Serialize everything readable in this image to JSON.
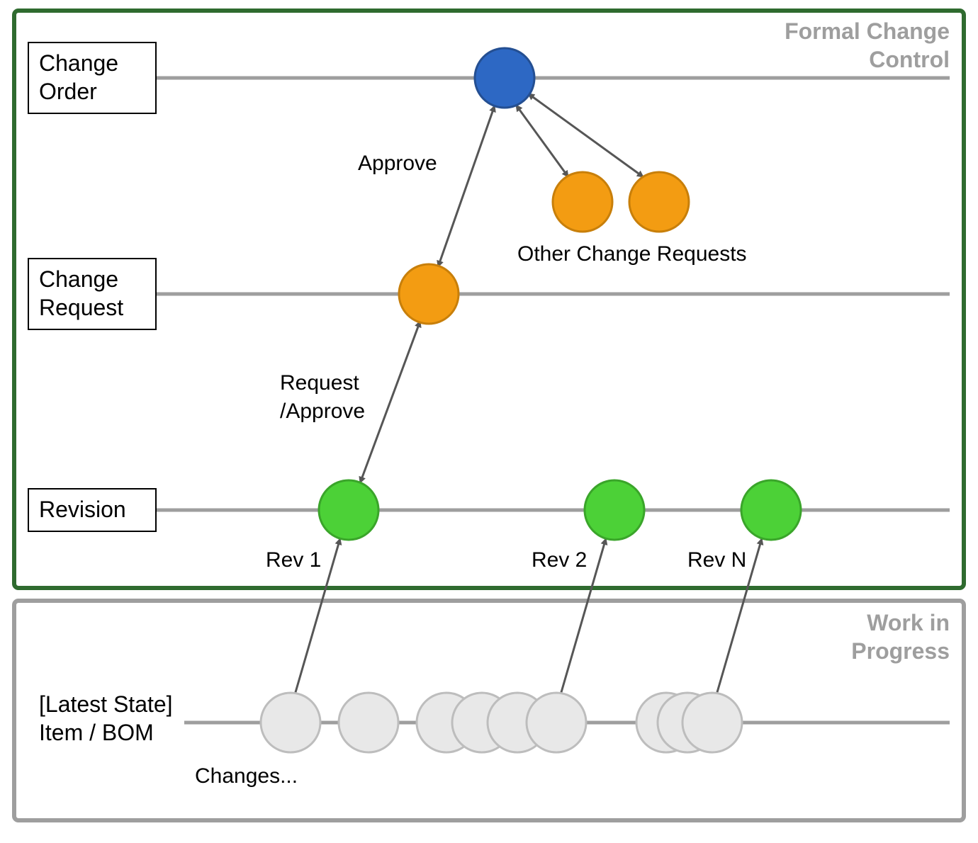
{
  "boxes": {
    "formal": {
      "title_line1": "Formal Change",
      "title_line2": "Control"
    },
    "wip": {
      "title_line1": "Work in",
      "title_line2": "Progress"
    }
  },
  "lanes": {
    "change_order": {
      "line1": "Change",
      "line2": "Order"
    },
    "change_request": {
      "line1": "Change",
      "line2": "Request"
    },
    "revision": {
      "line1": "Revision",
      "line2": ""
    },
    "latest_state": {
      "line1": "[Latest State]",
      "line2": "Item / BOM"
    }
  },
  "labels": {
    "approve": "Approve",
    "request_approve_line1": "Request",
    "request_approve_line2": "/Approve",
    "other_change_requests": "Other Change Requests",
    "rev1": "Rev 1",
    "rev2": "Rev 2",
    "revN": "Rev N",
    "changes": "Changes..."
  },
  "colors": {
    "green_box": "#2f6b2f",
    "grey_box": "#9e9e9e",
    "lane_line": "#9e9e9e",
    "blue_fill": "#2d68c4",
    "blue_stroke": "#244f92",
    "orange_fill": "#f39c12",
    "orange_stroke": "#c87f0a",
    "green_fill": "#4cd137",
    "green_stroke": "#3aa52a",
    "wip_fill": "#e8e8e8",
    "wip_stroke": "#bdbdbd",
    "arrow": "#565656"
  },
  "chart_data": {
    "type": "diagram",
    "title": "Formal Change Control vs Work in Progress",
    "lanes": [
      {
        "name": "Change Order",
        "box": "formal",
        "nodes": [
          {
            "id": "CO",
            "color": "blue"
          }
        ]
      },
      {
        "name": "Change Request",
        "box": "formal",
        "nodes": [
          {
            "id": "CR",
            "color": "orange"
          },
          {
            "id": "OCR1",
            "color": "orange",
            "label_group": "Other Change Requests"
          },
          {
            "id": "OCR2",
            "color": "orange",
            "label_group": "Other Change Requests"
          }
        ]
      },
      {
        "name": "Revision",
        "box": "formal",
        "nodes": [
          {
            "id": "Rev1",
            "color": "green",
            "label": "Rev 1"
          },
          {
            "id": "Rev2",
            "color": "green",
            "label": "Rev 2"
          },
          {
            "id": "RevN",
            "color": "green",
            "label": "Rev N"
          }
        ]
      },
      {
        "name": "[Latest State] Item / BOM",
        "box": "wip",
        "nodes": [
          {
            "id": "W1",
            "color": "grey",
            "group": 1
          },
          {
            "id": "W2",
            "color": "grey",
            "group": 1
          },
          {
            "id": "W3",
            "color": "grey",
            "group": 2
          },
          {
            "id": "W4",
            "color": "grey",
            "group": 2
          },
          {
            "id": "W5",
            "color": "grey",
            "group": 2
          },
          {
            "id": "W6",
            "color": "grey",
            "group": 2
          },
          {
            "id": "W7",
            "color": "grey",
            "group": 3
          },
          {
            "id": "W8",
            "color": "grey",
            "group": 3
          },
          {
            "id": "W9",
            "color": "grey",
            "group": 3
          }
        ],
        "group_label": "Changes..."
      }
    ],
    "edges": [
      {
        "from": "W1",
        "to": "Rev1",
        "style": "one-way"
      },
      {
        "from": "W6",
        "to": "Rev2",
        "style": "one-way"
      },
      {
        "from": "W9",
        "to": "RevN",
        "style": "one-way"
      },
      {
        "from": "Rev1",
        "to": "CR",
        "style": "two-way",
        "label": "Request /Approve"
      },
      {
        "from": "CR",
        "to": "CO",
        "style": "two-way",
        "label": "Approve"
      },
      {
        "from": "CO",
        "to": "OCR1",
        "style": "two-way"
      },
      {
        "from": "CO",
        "to": "OCR2",
        "style": "two-way"
      }
    ]
  }
}
